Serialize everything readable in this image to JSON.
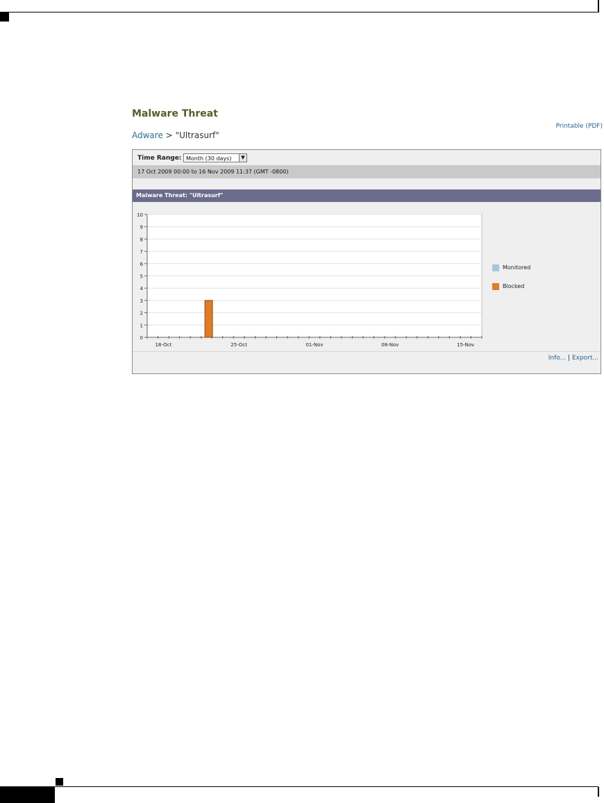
{
  "page": {
    "title": "Malware Threat",
    "printable_link": "Printable (PDF)",
    "breadcrumb": {
      "parent": "Adware",
      "separator": ">",
      "current": "\"Ultrasurf\""
    }
  },
  "panel": {
    "time_range_label": "Time Range:",
    "time_range_value": "Month (30 days)",
    "range_text": "17 Oct 2009 00:00 to 16 Nov 2009 11:37 (GMT -0800)",
    "chart_header": "Malware Threat: \"Ultrasurf\"",
    "info_link": "Info...",
    "link_separator": "|",
    "export_link": "Export..."
  },
  "colors": {
    "monitored": "#a4c8d8",
    "blocked": "#e07b26",
    "header": "#6b6b8b"
  },
  "chart_data": {
    "type": "bar",
    "x_start": "17-Oct",
    "x_tick_labels": [
      "18-Oct",
      "25-Oct",
      "01-Nov",
      "08-Nov",
      "15-Nov"
    ],
    "ylim": [
      0,
      10
    ],
    "y_ticks": [
      0,
      1,
      2,
      3,
      4,
      5,
      6,
      7,
      8,
      9,
      10
    ],
    "series": [
      {
        "name": "Monitored",
        "points": []
      },
      {
        "name": "Blocked",
        "points": [
          {
            "x": "22-Oct",
            "y": 3
          }
        ]
      }
    ],
    "legend_position": "right",
    "grid": true
  }
}
